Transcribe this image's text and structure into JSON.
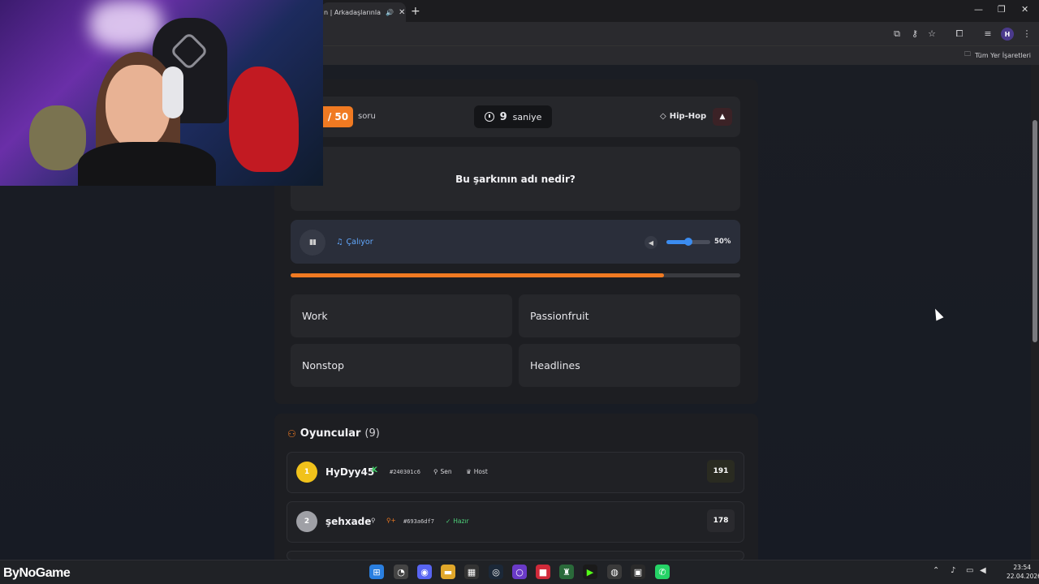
{
  "browser": {
    "tab_title": "n | Arkadaşlarınla",
    "new_tab": "+",
    "bookmark_folder": "Tüm Yer İşaretleri",
    "profile_initial": "H"
  },
  "game": {
    "question_counter": "/ 50",
    "question_word": "soru",
    "timer_value": "9",
    "timer_unit": "saniye",
    "genre": "Hip-Hop",
    "question": "Bu şarkının adı nedir?",
    "player_status": "Çalıyor",
    "volume_label": "50%",
    "volume_value": 0.5,
    "progress_value": 0.83,
    "answers": [
      "Work",
      "Passionfruit",
      "Nonstop",
      "Headlines"
    ]
  },
  "players": {
    "title": "Oyuncular",
    "count": "(9)",
    "list": [
      {
        "rank": "1",
        "name": "HyDyy45",
        "id": "#240301c6",
        "tag1": "Sen",
        "tag2": "Host",
        "score": "191"
      },
      {
        "rank": "2",
        "name": "şehxade",
        "id": "#693a6df7",
        "tag1": "Hazır",
        "score": "178"
      }
    ]
  },
  "taskbar": {
    "brand": "ByNoGame",
    "time": "23:54",
    "date": "22.04.2026"
  },
  "colors": {
    "accent": "#f07a22",
    "blue": "#3b8cf0",
    "ready": "#4ed37b"
  }
}
